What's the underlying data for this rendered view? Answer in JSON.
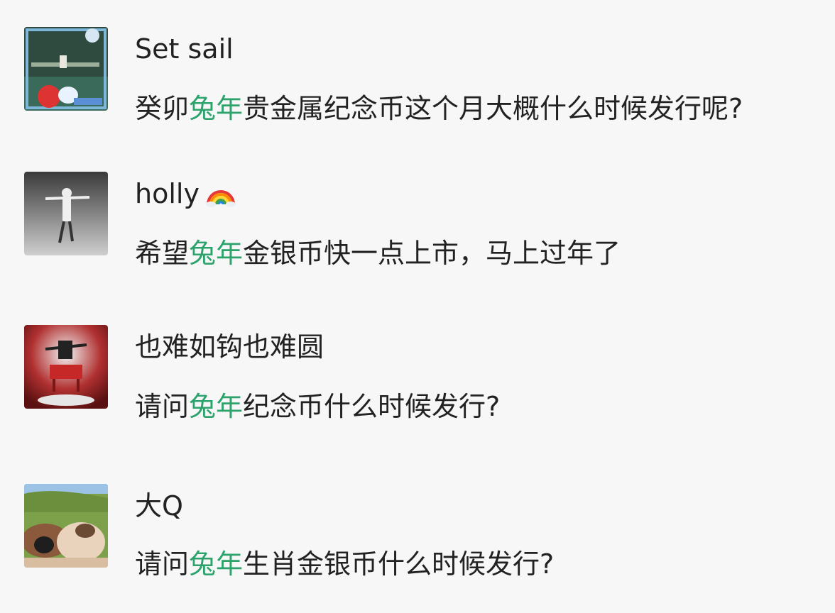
{
  "comments": [
    {
      "username": "Set sail",
      "text_before": "癸卯",
      "highlight": "兔年",
      "text_after": "贵金属纪念币这个月大概什么时候发行呢?",
      "avatar": "avatar-landscape-icon"
    },
    {
      "username": "holly",
      "username_emoji": "rainbow-icon",
      "text_before": "希望",
      "highlight": "兔年",
      "text_after": "金银币快一点上市，马上过年了",
      "avatar": "avatar-dancer-icon"
    },
    {
      "username": "也难如钩也难圆",
      "text_before": "请问",
      "highlight": "兔年",
      "text_after": "纪念币什么时候发行?",
      "avatar": "avatar-stage-icon"
    },
    {
      "username": "大Q",
      "text_before": "请问",
      "highlight": "兔年",
      "text_after": "生肖金银币什么时候发行?",
      "avatar": "avatar-cows-icon"
    }
  ],
  "colors": {
    "background": "#f7f7f8",
    "text": "#222222",
    "highlight": "#2ba36b"
  }
}
